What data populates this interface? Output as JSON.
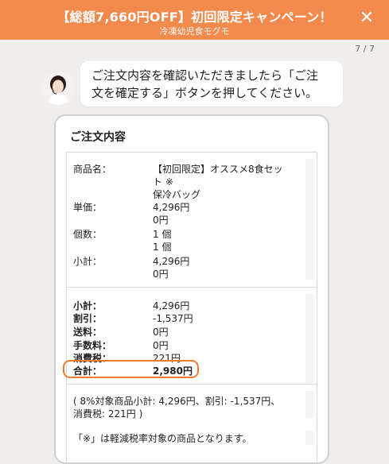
{
  "header": {
    "title": "【総額7,660円OFF】初回限定キャンペーン！",
    "subtitle": "冷凍幼児食モグモ",
    "close_icon": "close-icon",
    "progress": "7 / 7",
    "accent": "#f18a4c"
  },
  "chat": {
    "message_line1": "ご注文内容を確認いただきましたら「ご注",
    "message_line2": "文を確定する」ボタンを押してください。"
  },
  "order": {
    "title": "ご注文内容",
    "product_label": "商品名：",
    "product_line1": "【初回限定】オススメ8食セッ",
    "product_line2": "ト ※",
    "product_line3": "保冷バッグ",
    "unit_price_label": "単価：",
    "unit_price_1": "4,296円",
    "unit_price_2": "0円",
    "qty_label": "個数：",
    "qty_1": "1 個",
    "qty_2": "1 個",
    "line_subtotal_label": "小計：",
    "line_subtotal_1": "4,296円",
    "line_subtotal_2": "0円",
    "subtotal_label": "小計：",
    "subtotal_value": "4,296円",
    "discount_label": "割引：",
    "discount_value": "-1,537円",
    "shipping_label": "送料：",
    "shipping_value": "0円",
    "fee_label": "手数料：",
    "fee_value": "0円",
    "tax_label": "消費税：",
    "tax_value": "221円",
    "total_label": "合計：",
    "total_value": "2,980円",
    "tax_note_line1": "( 8%対象商品小計: 4,296円、割引: -1,537円、",
    "tax_note_line2": "消費税: 221円 )",
    "reduced_rate_note": "「※」は軽減税率対象の商品となります。",
    "highlight_color": "#f07b2f"
  }
}
